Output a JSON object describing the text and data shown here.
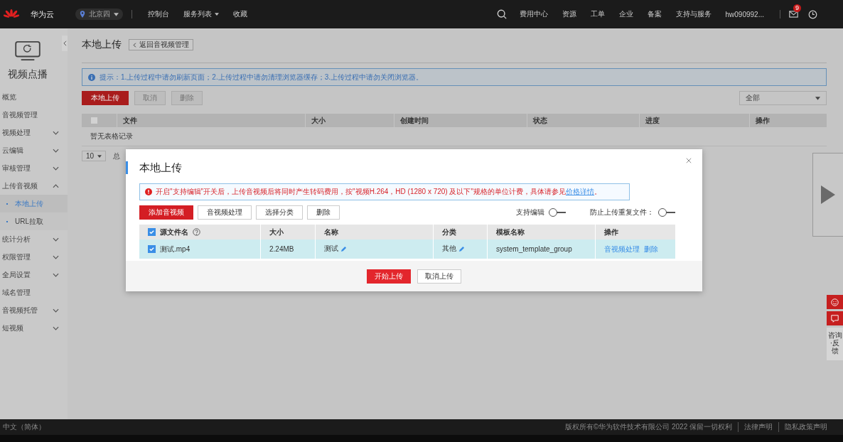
{
  "header": {
    "logo_text": "华为云",
    "region": "北京四",
    "nav": [
      {
        "label": "控制台",
        "has_menu": false
      },
      {
        "label": "服务列表",
        "has_menu": true
      },
      {
        "label": "收藏",
        "has_menu": false
      }
    ],
    "links": [
      "费用中心",
      "资源",
      "工单",
      "企业",
      "备案",
      "支持与服务"
    ],
    "user": "hw090992...",
    "mail_badge": "9"
  },
  "sidebar": {
    "title": "视频点播",
    "items": [
      {
        "label": "概览",
        "selected": false
      },
      {
        "label": "音视频管理",
        "selected": false
      },
      {
        "label": "视频处理",
        "selected": false,
        "expanded": false
      },
      {
        "label": "云编辑",
        "selected": false,
        "expanded": false
      },
      {
        "label": "审核管理",
        "selected": false,
        "expanded": false
      },
      {
        "label": "上传音视频",
        "selected": false,
        "expanded": true,
        "children": [
          {
            "label": "本地上传",
            "selected": true
          },
          {
            "label": "URL拉取",
            "selected": false
          }
        ]
      },
      {
        "label": "统计分析",
        "selected": false,
        "expanded": false
      },
      {
        "label": "权限管理",
        "selected": false,
        "expanded": false
      },
      {
        "label": "全局设置",
        "selected": false,
        "expanded": false
      },
      {
        "label": "域名管理",
        "selected": false
      },
      {
        "label": "音视频托管",
        "selected": false,
        "expanded": false
      },
      {
        "label": "短视频",
        "selected": false,
        "expanded": false
      }
    ]
  },
  "page": {
    "title": "本地上传",
    "back_button": "返回音视频管理",
    "notice": "提示：1.上传过程中请勿刷新页面；2.上传过程中请勿清理浏览器缓存；3.上传过程中请勿关闭浏览器。",
    "buttons": [
      {
        "label": "本地上传",
        "kind": "primary"
      },
      {
        "label": "取消",
        "kind": "disabled"
      },
      {
        "label": "删除",
        "kind": "disabled"
      }
    ],
    "filter": "全部",
    "table": {
      "header_checked": false,
      "columns": [
        "文件",
        "大小",
        "创建时间",
        "状态",
        "进度",
        "操作"
      ],
      "empty_text": "暂无表格记录"
    },
    "pagination": {
      "page_size": "10",
      "total": "总"
    }
  },
  "dialog": {
    "title": "本地上传",
    "alert": {
      "text": "开启\"支持编辑\"开关后，上传音视频后将同时产生转码费用，按\"视频H.264，HD (1280 x 720) 及以下\"规格的单位计费，具体请参见",
      "link": "价格详情",
      "end": "。"
    },
    "buttons": [
      {
        "label": "添加音视频",
        "kind": "primary"
      },
      {
        "label": "音视频处理",
        "kind": "default"
      },
      {
        "label": "选择分类",
        "kind": "default"
      },
      {
        "label": "删除",
        "kind": "default"
      }
    ],
    "toggles": [
      {
        "label": "支持编辑",
        "on": false
      },
      {
        "label": "防止上传重复文件：",
        "on": false
      }
    ],
    "table": {
      "header_checked": true,
      "columns": [
        "源文件名",
        "大小",
        "名称",
        "分类",
        "模板名称",
        "操作"
      ],
      "rows": [
        {
          "checked": true,
          "file": "测试.mp4",
          "size": "2.24MB",
          "name": "测试",
          "category": "其他",
          "template": "system_template_group",
          "actions": [
            "音视频处理",
            "删除"
          ]
        }
      ]
    },
    "footer_buttons": [
      {
        "label": "开始上传",
        "kind": "primary"
      },
      {
        "label": "取消上传",
        "kind": "default"
      }
    ]
  },
  "feedback": {
    "label": "咨询·反馈"
  },
  "footer": {
    "language": "中文（简体）",
    "copyright": "版权所有©华为软件技术有限公司 2022 保留一切权利",
    "links": [
      "法律声明",
      "隐私政策声明"
    ]
  }
}
